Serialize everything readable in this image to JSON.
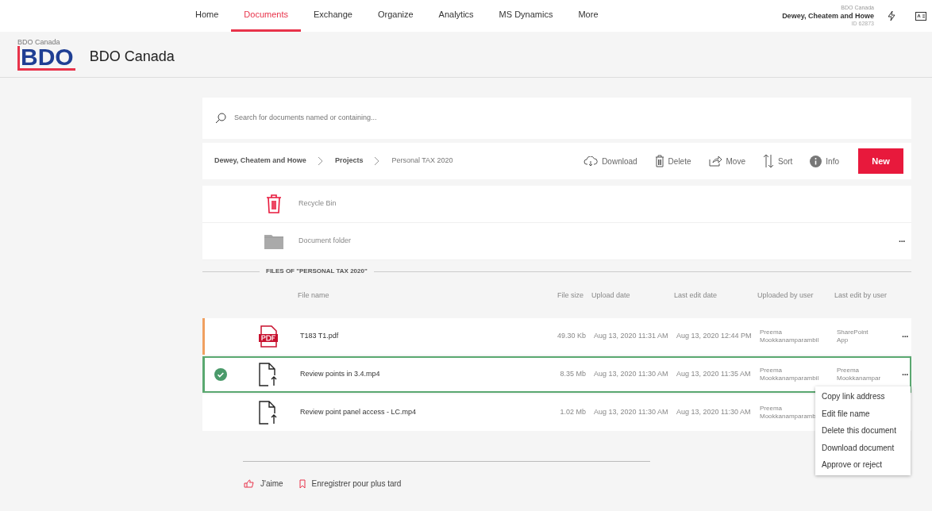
{
  "nav": {
    "tabs": [
      {
        "label": "Home",
        "selected": false
      },
      {
        "label": "Documents",
        "selected": true
      },
      {
        "label": "Exchange",
        "selected": false
      },
      {
        "label": "Organize",
        "selected": false
      },
      {
        "label": "Analytics",
        "selected": false
      },
      {
        "label": "MS Dynamics",
        "selected": false
      },
      {
        "label": "More",
        "selected": false
      }
    ],
    "user": {
      "org": "BDO Canada",
      "name": "Dewey, Cheatem and Howe",
      "id": "ID 62873"
    }
  },
  "header": {
    "caption": "BDO Canada",
    "logo": "BDO",
    "title": "BDO Canada"
  },
  "search": {
    "placeholder": "Search for documents named or containing..."
  },
  "breadcrumb": [
    {
      "label": "Dewey, Cheatem and Howe",
      "current": false
    },
    {
      "label": "Projects",
      "current": false
    },
    {
      "label": "Personal TAX 2020",
      "current": true
    }
  ],
  "toolbar": [
    {
      "kind": "download",
      "label": "Download"
    },
    {
      "kind": "delete",
      "label": "Delete"
    },
    {
      "kind": "move",
      "label": "Move"
    },
    {
      "kind": "sort",
      "label": "Sort"
    },
    {
      "kind": "info",
      "label": "Info"
    }
  ],
  "new_button": "New",
  "folders": [
    {
      "kind": "bin",
      "label": "Recycle Bin"
    },
    {
      "kind": "folder",
      "label": "Document folder",
      "more": "···"
    }
  ],
  "section_title": "FILES OF \"PERSONAL TAX 2020\"",
  "columns": [
    "File name",
    "File size",
    "Upload date",
    "Last edit date",
    "Uploaded by user",
    "Last edit by user"
  ],
  "files": [
    {
      "kind": "pdf",
      "name": "T183 T1.pdf",
      "size": "49.30 Kb",
      "uploaded": "Aug 13, 2020 11:31 AM",
      "edited": "Aug 13, 2020 12:44 PM",
      "uploaded_by": "Preema Mookkanamparambil",
      "edited_by": "SharePoint App",
      "selected": false,
      "color": "#f0a060",
      "more": "···"
    },
    {
      "kind": "upload",
      "name": "Review points in 3.4.mp4",
      "size": "8.35 Mb",
      "uploaded": "Aug 13, 2020 11:30 AM",
      "edited": "Aug 13, 2020 11:35 AM",
      "uploaded_by": "Preema Mookkanamparambil",
      "edited_by": "Preema Mookkanampar",
      "selected": true,
      "color": "#5aa870",
      "more": "···"
    },
    {
      "kind": "upload",
      "name": "Review point panel access - LC.mp4",
      "size": "1.02 Mb",
      "uploaded": "Aug 13, 2020 11:30 AM",
      "edited": "Aug 13, 2020 11:30 AM",
      "uploaded_by": "Preema Mookkanamparamb",
      "selected": false
    }
  ],
  "context_menu": [
    "Copy link address",
    "Edit file name",
    "Delete this document",
    "Download document",
    "Approve or reject"
  ],
  "footer": {
    "like": "J'aime",
    "save": "Enregistrer pour plus tard"
  }
}
